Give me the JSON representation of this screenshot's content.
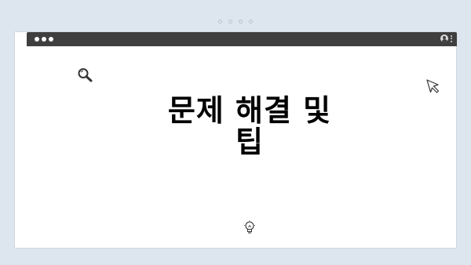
{
  "window": {
    "title_bar_dots": 3,
    "page_indicator_dots": 4
  },
  "icons": {
    "search": "search-icon",
    "cursor": "cursor-arrow-icon",
    "lightbulb": "lightbulb-icon",
    "user": "user-icon",
    "menu": "kebab-menu-icon"
  },
  "colors": {
    "background": "#dde6ee",
    "titlebar": "#3f3f3f",
    "content": "#ffffff",
    "text": "#000000"
  },
  "main": {
    "headline_line1": "문제 해결 및",
    "headline_line2": "팁"
  }
}
